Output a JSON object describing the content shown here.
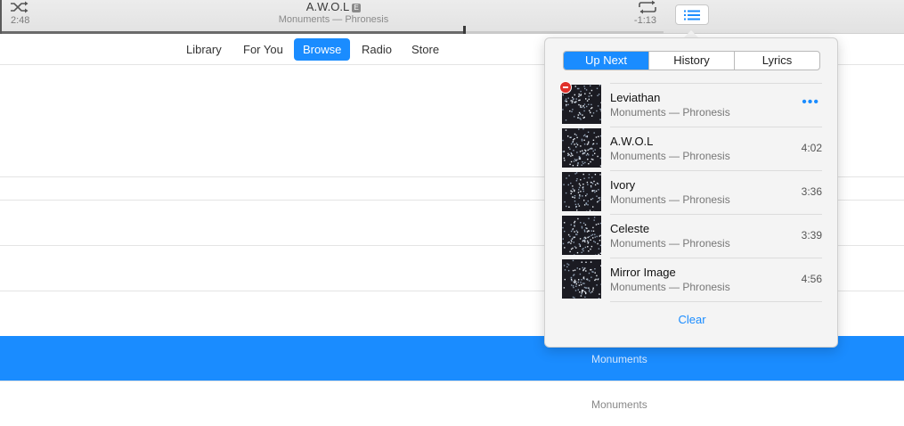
{
  "player": {
    "elapsed": "2:48",
    "remaining": "-1:13",
    "title": "A.W.O.L",
    "explicit_badge": "E",
    "subtitle": "Monuments — Phronesis",
    "progress": 0.7
  },
  "nav": {
    "tabs": [
      {
        "label": "Library"
      },
      {
        "label": "For You"
      },
      {
        "label": "Browse"
      },
      {
        "label": "Radio"
      },
      {
        "label": "Store"
      }
    ],
    "active": "Browse"
  },
  "content": {
    "rows": [
      {
        "text": "Monuments"
      },
      {
        "text": "Monuments"
      }
    ]
  },
  "popover": {
    "tabs": [
      {
        "label": "Up Next"
      },
      {
        "label": "History"
      },
      {
        "label": "Lyrics"
      }
    ],
    "active_tab": "Up Next",
    "queue": [
      {
        "title": "Leviathan",
        "subtitle": "Monuments — Phronesis",
        "duration": ""
      },
      {
        "title": "A.W.O.L",
        "subtitle": "Monuments — Phronesis",
        "duration": "4:02"
      },
      {
        "title": "Ivory",
        "subtitle": "Monuments — Phronesis",
        "duration": "3:36"
      },
      {
        "title": "Celeste",
        "subtitle": "Monuments — Phronesis",
        "duration": "3:39"
      },
      {
        "title": "Mirror Image",
        "subtitle": "Monuments — Phronesis",
        "duration": "4:56"
      }
    ],
    "more_glyph": "•••",
    "clear_label": "Clear"
  },
  "colors": {
    "accent": "#1a8cff",
    "remove": "#e0302a"
  },
  "icons": [
    "shuffle-icon",
    "repeat-icon",
    "list-icon",
    "remove-icon",
    "more-icon"
  ]
}
